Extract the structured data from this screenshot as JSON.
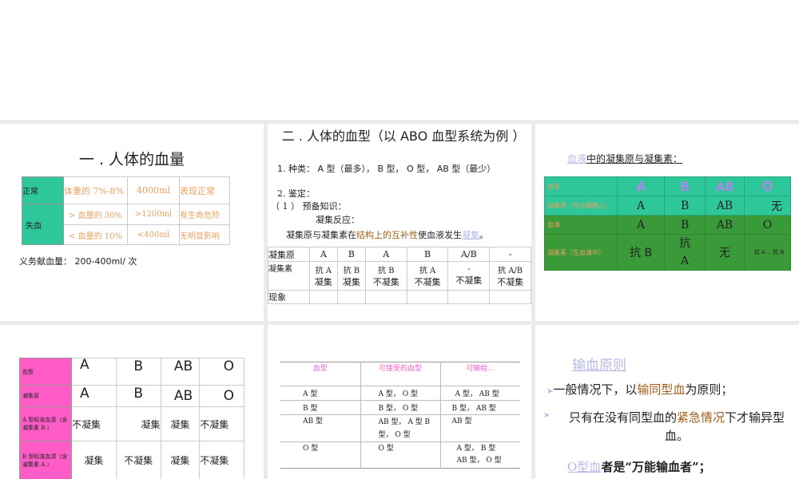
{
  "colors": {
    "teal": "#2ec79a",
    "green": "#3a9a3a",
    "pink": "#ff5cc8",
    "orange": "#e8a060",
    "brown": "#a0601a",
    "link": "#b8b8e8",
    "gap": "#ebebeb"
  },
  "slide1": {
    "title": "一 . 人体的血量",
    "rows": [
      [
        "正常",
        "体重的 7%-8%",
        "4000ml",
        "表现正常"
      ],
      [
        "失血",
        "> 血量的 30%",
        ">1200ml",
        "有生命危险"
      ],
      [
        "",
        "< 血量的 10%",
        "<400ml",
        "无明显影响"
      ]
    ],
    "note": "义务献血量： 200-400ml/ 次"
  },
  "slide2": {
    "title": "二 . 人体的血型（以 ABO 血型系统为例 ）",
    "line1": "1. 种类： A 型（最多）， B 型， O 型， AB 型（最少）",
    "line2": "2. 鉴定：",
    "line3": "（ 1 ） 预备知识：",
    "line4": "凝集反应：",
    "line5a": "凝集原与凝集素在",
    "line5b": "结构上的互补性",
    "line5c": "使血液发生",
    "line5d": "凝集",
    "line5e": "。",
    "table": {
      "r1": [
        "凝集原",
        "A",
        "B",
        "A",
        "B",
        "A/B",
        "-"
      ],
      "r2": [
        "凝集素",
        "抗 A",
        "抗 B",
        "抗 B",
        "抗 A",
        "-",
        "抗 A/B"
      ],
      "r2b": [
        "",
        "凝集",
        "凝集",
        "不凝集",
        "不凝集",
        "不凝集",
        "不凝集"
      ],
      "r3": [
        "现象",
        "",
        "",
        "",
        "",
        "",
        ""
      ]
    }
  },
  "slide3": {
    "title_link": "血液",
    "title_rest": "中的凝集原与凝集素：",
    "rows": [
      [
        "血型",
        "A",
        "B",
        "AB",
        "O"
      ],
      [
        "凝集原（在红细胞上）",
        "A",
        "B",
        "AB",
        "无"
      ],
      [
        "血清",
        "A",
        "B",
        "AB",
        "O"
      ],
      [
        "凝集素（在血清中）",
        "抗 B",
        "抗 A",
        "无",
        "抗 A 、抗 B"
      ]
    ]
  },
  "slide4": {
    "rows": [
      [
        "血型",
        "A",
        "B",
        "AB",
        "O"
      ],
      [
        "凝集原",
        "A",
        "B",
        "AB",
        "O"
      ],
      [
        "A 型标准血清（含凝集素 B ）",
        "不凝集",
        "凝集",
        "凝集",
        "不凝集"
      ],
      [
        "B 型标准血清（含凝集素 A ）",
        "凝集",
        "不凝集",
        "凝集",
        "不凝集"
      ]
    ]
  },
  "slide5": {
    "headers": [
      "血型",
      "可接受的血型",
      "可输给…"
    ],
    "rows": [
      [
        "A 型",
        "A 型， O 型",
        "A 型， AB 型"
      ],
      [
        "B 型",
        "B 型， O 型",
        "B 型， AB 型"
      ],
      [
        "AB 型",
        "AB 型， A 型 B 型， O 型",
        "AB 型"
      ],
      [
        "O 型",
        "O 型",
        "A 型， B 型 AB 型， O 型"
      ]
    ]
  },
  "slide6": {
    "title": "输血原则",
    "b1a": "一般情况下，以",
    "b1b": "输同型血",
    "b1c": "为原则；",
    "b2a": "只有在没有同型血的",
    "b2b": "紧急情况",
    "b2c": "下才输异型血。",
    "b3a": "O型血",
    "b3b": "者是“万能输血者”；"
  }
}
